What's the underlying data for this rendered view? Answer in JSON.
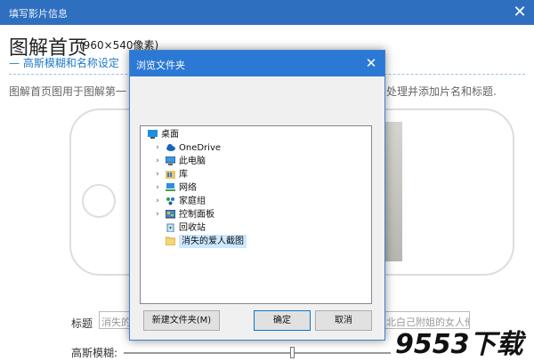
{
  "parent_window": {
    "title": "填写影片信息",
    "close_glyph": "✕"
  },
  "page": {
    "title": "图解首页",
    "size": "(960×540像素)",
    "subtitle": "— 高斯模糊和名称设定",
    "description_left": "图解首页图用于图解第一",
    "description_right": "处理并添加片名和标题."
  },
  "form": {
    "title_label": "标题",
    "title_value_left": "消失的",
    "title_value_right": "北白己附姐的女人他",
    "blur_label": "高斯模糊:",
    "blur_level_fraction": 0.63
  },
  "watermark": {
    "text": "9553下载"
  },
  "dialog": {
    "title": "浏览文件夹",
    "close_glyph": "✕",
    "tree": [
      {
        "label": "桌面",
        "icon": "desktop-icon",
        "expander": ""
      },
      {
        "label": "OneDrive",
        "icon": "onedrive-icon",
        "expander": "›"
      },
      {
        "label": "此电脑",
        "icon": "computer-icon",
        "expander": "›"
      },
      {
        "label": "库",
        "icon": "library-icon",
        "expander": "›"
      },
      {
        "label": "网络",
        "icon": "network-icon",
        "expander": "›"
      },
      {
        "label": "家庭组",
        "icon": "homegroup-icon",
        "expander": "›"
      },
      {
        "label": "控制面板",
        "icon": "control-panel-icon",
        "expander": "›"
      },
      {
        "label": "回收站",
        "icon": "recycle-bin-icon",
        "expander": ""
      },
      {
        "label": "消失的爱人截图",
        "icon": "folder-icon",
        "expander": ""
      }
    ],
    "selected_item": "消失的爱人截图",
    "new_folder_button": "新建文件夹(M)",
    "ok_button": "确定",
    "cancel_button": "取消"
  },
  "colors": {
    "titlebar": "#2f6fc0",
    "dialog_titlebar": "#2b79d4",
    "accent": "#1f78c9",
    "selection": "#cce8ff"
  }
}
